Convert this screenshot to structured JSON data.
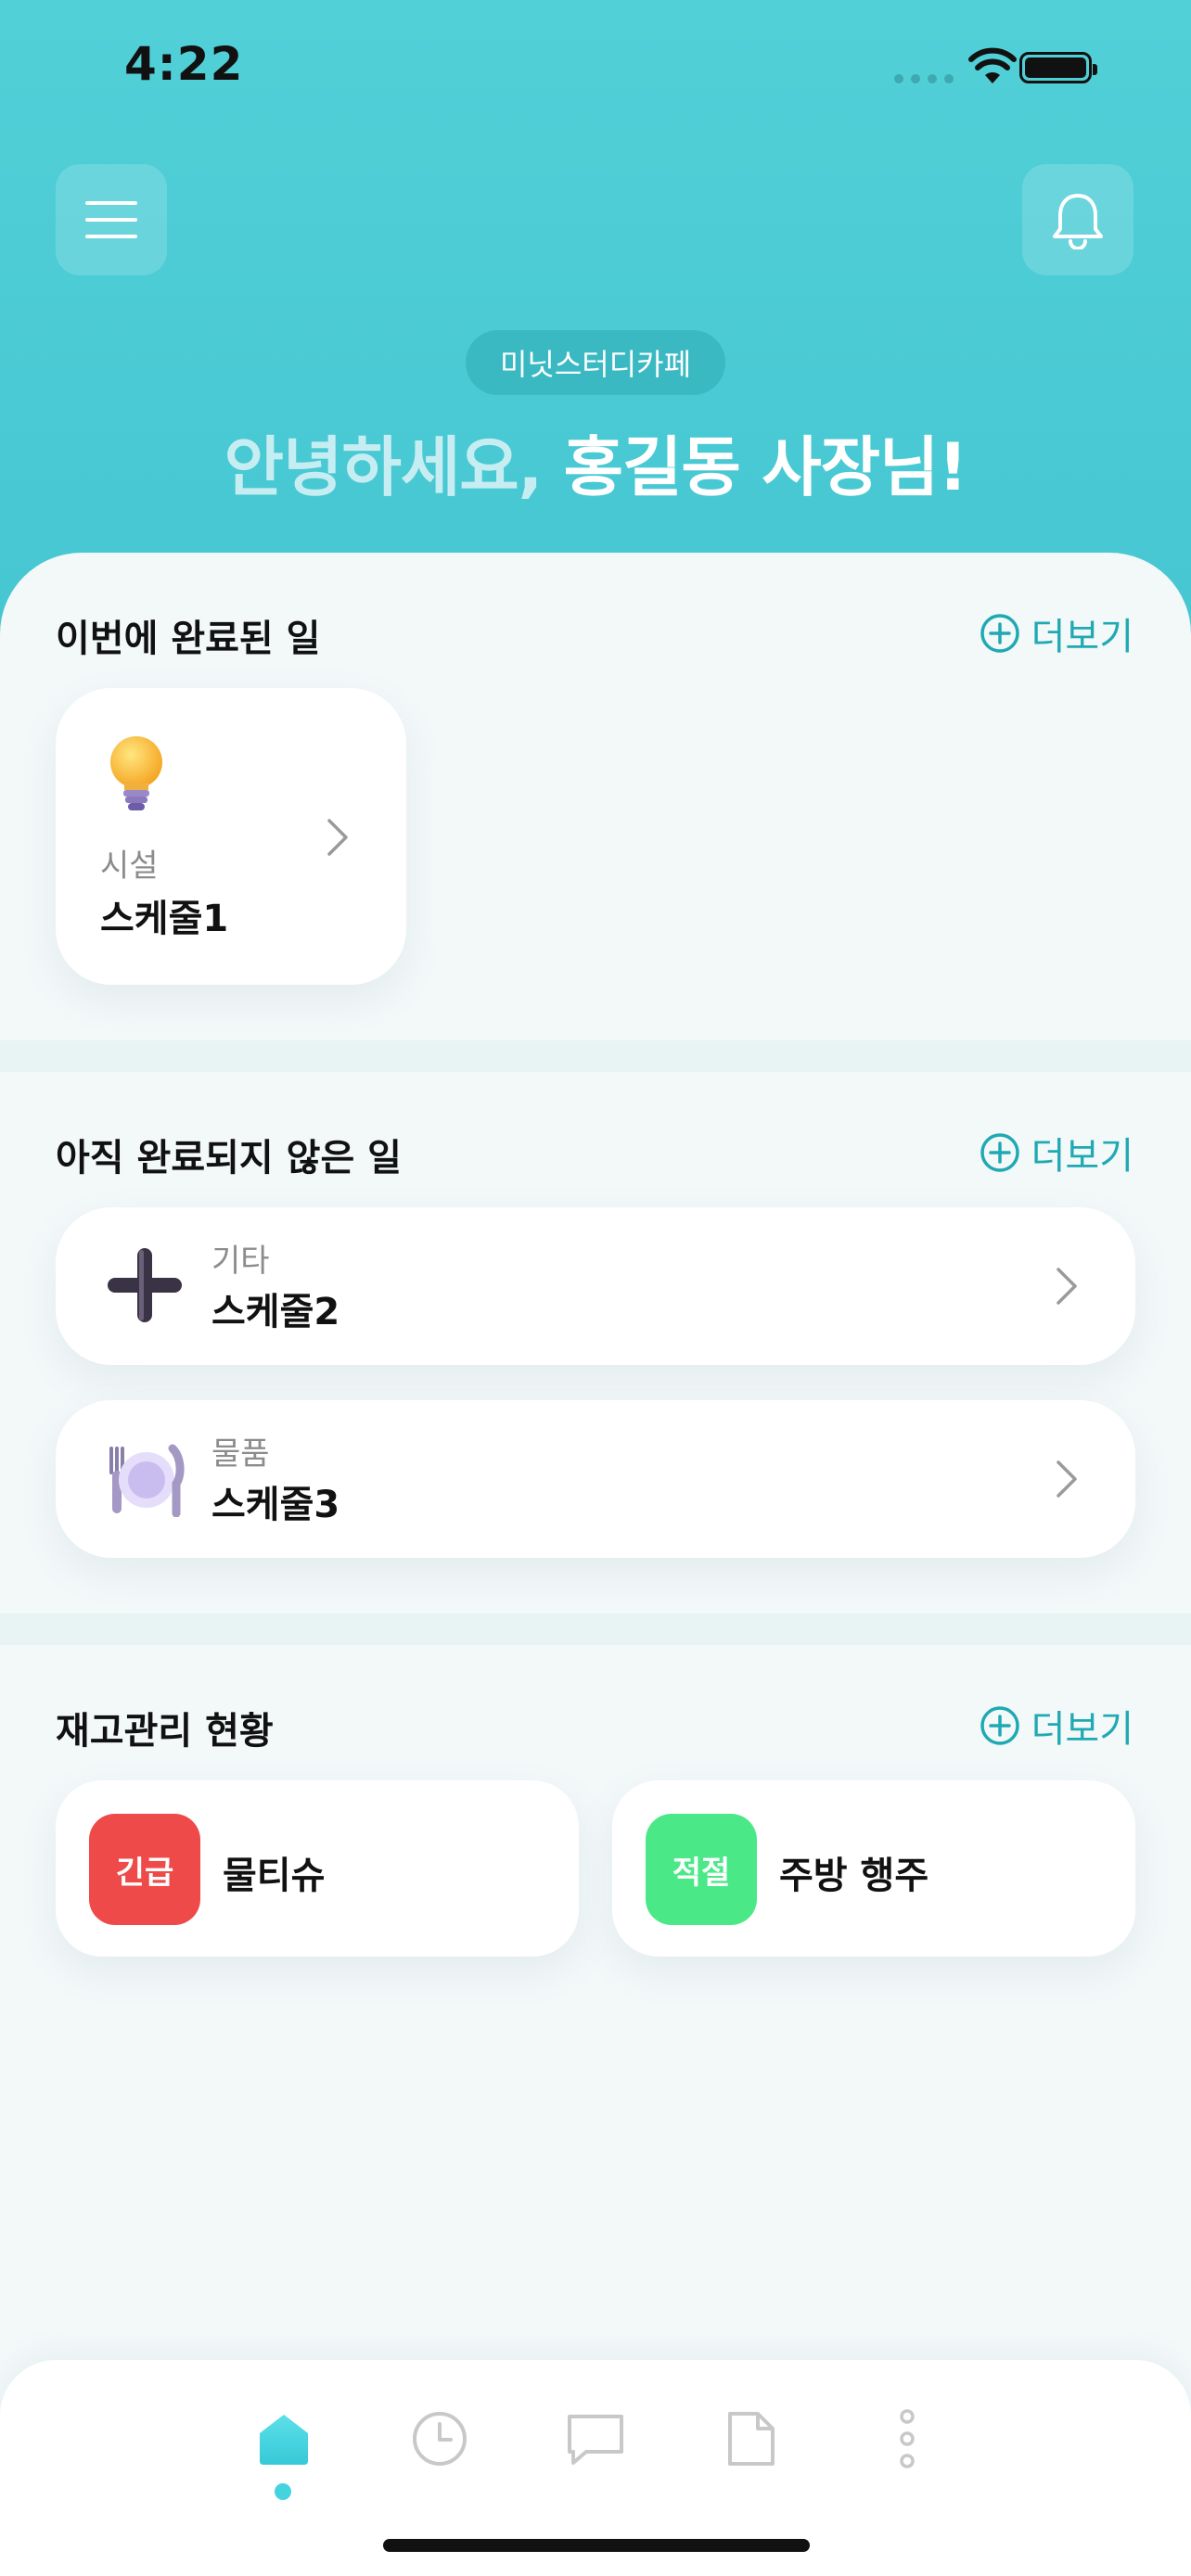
{
  "status_bar": {
    "time": "4:22"
  },
  "header": {
    "store_name": "미닛스터디카페",
    "greeting_part1": "안녕하세요, ",
    "greeting_part2": "홍길동 사장님!"
  },
  "completed": {
    "title": "이번에 완료된 일",
    "more_label": "더보기",
    "items": [
      {
        "icon": "lightbulb-icon",
        "category": "시설",
        "name": "스케줄1"
      }
    ]
  },
  "incomplete": {
    "title": "아직 완료되지 않은 일",
    "more_label": "더보기",
    "items": [
      {
        "icon": "plus-icon",
        "category": "기타",
        "name": "스케줄2"
      },
      {
        "icon": "plate-cutlery-icon",
        "category": "물품",
        "name": "스케줄3"
      }
    ]
  },
  "inventory": {
    "title": "재고관리 현황",
    "more_label": "더보기",
    "items": [
      {
        "badge": "긴급",
        "badge_color": "#ee4a4a",
        "name": "물티슈"
      },
      {
        "badge": "적절",
        "badge_color": "#4be888",
        "name": "주방 행주"
      }
    ]
  },
  "tab_bar": {
    "tabs": [
      {
        "icon": "home-icon",
        "active": true
      },
      {
        "icon": "clock-icon",
        "active": false
      },
      {
        "icon": "chat-icon",
        "active": false
      },
      {
        "icon": "document-icon",
        "active": false
      },
      {
        "icon": "more-vertical-icon",
        "active": false
      }
    ],
    "accent": "#45d3e0"
  },
  "colors": {
    "header_bg": "#4ecbd5",
    "accent": "#1fa9b3"
  }
}
